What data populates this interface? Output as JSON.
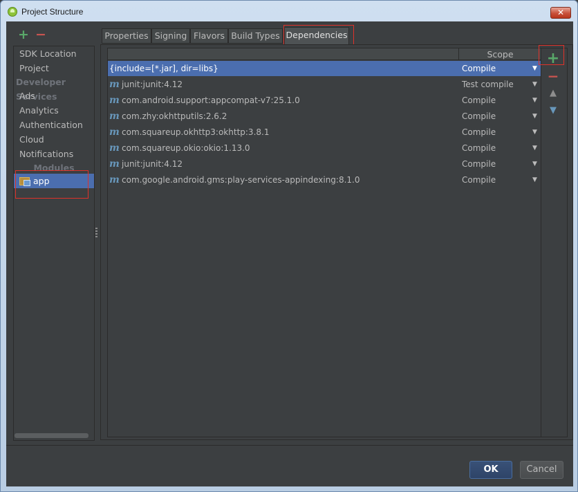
{
  "window": {
    "title": "Project Structure",
    "close_label": "✕"
  },
  "left_toolbar": {
    "add_label": "+",
    "remove_label": "−"
  },
  "sidebar": {
    "items": [
      {
        "label": "SDK Location"
      },
      {
        "label": "Project"
      }
    ],
    "developer_services_header": "Developer Services",
    "services": [
      {
        "label": "Ads"
      },
      {
        "label": "Analytics"
      },
      {
        "label": "Authentication"
      },
      {
        "label": "Cloud"
      },
      {
        "label": "Notifications"
      }
    ],
    "modules_header": "Modules",
    "modules": [
      {
        "label": "app",
        "icon": "module-icon",
        "selected": true
      }
    ]
  },
  "tabs": [
    {
      "label": "Properties"
    },
    {
      "label": "Signing"
    },
    {
      "label": "Flavors"
    },
    {
      "label": "Build Types"
    },
    {
      "label": "Dependencies",
      "active": true
    }
  ],
  "table": {
    "columns": {
      "name": "",
      "scope": "Scope"
    },
    "rows": [
      {
        "name": "{include=[*.jar], dir=libs}",
        "scope": "Compile",
        "icon": "",
        "selected": true
      },
      {
        "name": "junit:junit:4.12",
        "scope": "Test compile",
        "icon": "maven-icon"
      },
      {
        "name": "com.android.support:appcompat-v7:25.1.0",
        "scope": "Compile",
        "icon": "maven-icon"
      },
      {
        "name": "com.zhy:okhttputils:2.6.2",
        "scope": "Compile",
        "icon": "maven-icon"
      },
      {
        "name": "com.squareup.okhttp3:okhttp:3.8.1",
        "scope": "Compile",
        "icon": "maven-icon"
      },
      {
        "name": "com.squareup.okio:okio:1.13.0",
        "scope": "Compile",
        "icon": "maven-icon"
      },
      {
        "name": "junit:junit:4.12",
        "scope": "Compile",
        "icon": "maven-icon"
      },
      {
        "name": "com.google.android.gms:play-services-appindexing:8.1.0",
        "scope": "Compile",
        "icon": "maven-icon"
      }
    ],
    "maven_glyph": "m",
    "dropdown_glyph": "▼"
  },
  "right_toolbar": {
    "add_label": "+",
    "remove_label": "−",
    "up_label": "▲",
    "down_label": "▼"
  },
  "buttons": {
    "ok": "OK",
    "cancel": "Cancel"
  },
  "colors": {
    "selection": "#4b6eaf",
    "add": "#59a869",
    "remove": "#c75450",
    "highlight": "#e0322a"
  }
}
